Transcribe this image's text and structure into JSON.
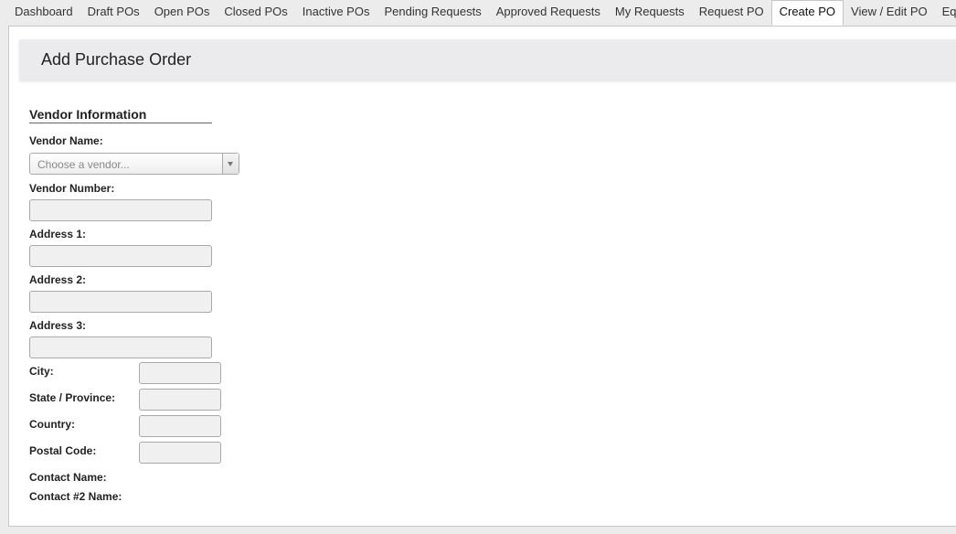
{
  "tabs": [
    {
      "label": "Dashboard"
    },
    {
      "label": "Draft POs"
    },
    {
      "label": "Open POs"
    },
    {
      "label": "Closed POs"
    },
    {
      "label": "Inactive POs"
    },
    {
      "label": "Pending Requests"
    },
    {
      "label": "Approved Requests"
    },
    {
      "label": "My Requests"
    },
    {
      "label": "Request PO"
    },
    {
      "label": "Create PO",
      "active": true
    },
    {
      "label": "View / Edit PO"
    },
    {
      "label": "Equipment"
    }
  ],
  "header": {
    "title": "Add Purchase Order"
  },
  "vendor": {
    "section_title": "Vendor Information",
    "vendor_name_label": "Vendor Name:",
    "vendor_name_placeholder": "Choose a vendor...",
    "vendor_number_label": "Vendor Number:",
    "address1_label": "Address 1:",
    "address2_label": "Address 2:",
    "address3_label": "Address 3:",
    "city_label": "City:",
    "state_label": "State / Province:",
    "country_label": "Country:",
    "postal_label": "Postal Code:",
    "contact_label": "Contact Name:",
    "contact2_label": "Contact #2 Name:"
  }
}
